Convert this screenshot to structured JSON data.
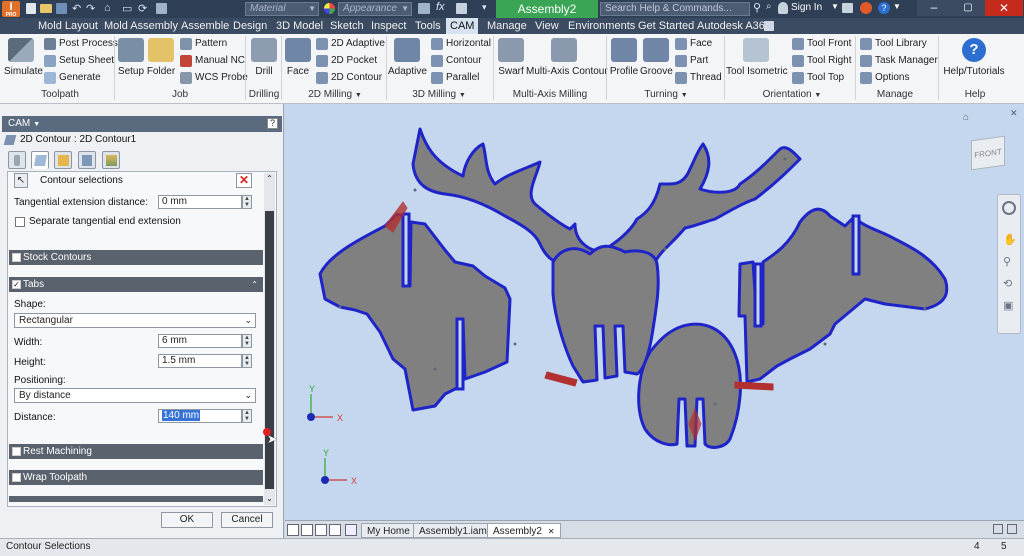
{
  "title": {
    "app_badge": "PRO",
    "quick_material": "Material",
    "quick_appearance": "Appearance",
    "fx": "fx",
    "document": "Assembly2",
    "search_placeholder": "Search Help & Commands...",
    "sign_in": "Sign In"
  },
  "menu": [
    "Mold Layout",
    "Mold Assembly",
    "Assemble",
    "Design",
    "3D Model",
    "Sketch",
    "Inspect",
    "Tools",
    "CAM",
    "Manage",
    "View",
    "Environments",
    "Get Started",
    "Autodesk A360"
  ],
  "menu_active": "CAM",
  "ribbon": {
    "simulate": "Simulate",
    "post_process": "Post Process",
    "setup_sheet": "Setup Sheet",
    "generate": "Generate",
    "setup": "Setup",
    "folder": "Folder",
    "pattern": "Pattern",
    "manual_nc": "Manual NC",
    "wcs_probe": "WCS Probe",
    "drill": "Drill",
    "face": "Face",
    "adaptive_2d": "2D Adaptive",
    "pocket_2d": "2D Pocket",
    "contour_2d": "2D Contour",
    "adaptive": "Adaptive",
    "horizontal": "Horizontal",
    "contour": "Contour",
    "parallel": "Parallel",
    "swarf": "Swarf",
    "multi_axis_contour": "Multi-Axis Contour",
    "profile": "Profile",
    "groove": "Groove",
    "t_face": "Face",
    "t_part": "Part",
    "t_thread": "Thread",
    "tool_isometric": "Tool Isometric",
    "tool_front": "Tool Front",
    "tool_right": "Tool Right",
    "tool_top": "Tool Top",
    "tool_library": "Tool Library",
    "task_manager": "Task Manager",
    "options": "Options",
    "help_tutorials": "Help/Tutorials",
    "groups": {
      "toolpath": "Toolpath",
      "job": "Job",
      "drilling": "Drilling",
      "milling_2d": "2D Milling",
      "milling_3d": "3D Milling",
      "multi_axis": "Multi-Axis Milling",
      "turning": "Turning",
      "orientation": "Orientation",
      "manage": "Manage",
      "help": "Help"
    }
  },
  "panel": {
    "header": "CAM",
    "help_glyph": "?",
    "breadcrumb": "2D Contour : 2D Contour1",
    "contour_selections": "Contour selections",
    "tangential_label": "Tangential extension distance:",
    "tangential_value": "0 mm",
    "separate_label": "Separate tangential end extension",
    "stock_contours": "Stock Contours",
    "tabs": "Tabs",
    "shape_label": "Shape:",
    "shape_value": "Rectangular",
    "width_label": "Width:",
    "width_value": "6 mm",
    "height_label": "Height:",
    "height_value": "1.5 mm",
    "positioning_label": "Positioning:",
    "positioning_value": "By distance",
    "distance_label": "Distance:",
    "distance_value": "140 mm",
    "rest_machining": "Rest Machining",
    "wrap_toolpath": "Wrap Toolpath",
    "ok": "OK",
    "cancel": "Cancel"
  },
  "viewcube_label": "FRONT",
  "axis": {
    "x": "X",
    "y": "Y"
  },
  "doc_tabs": [
    "My Home",
    "Assembly1.iam",
    "Assembly2"
  ],
  "doc_tab_active": "Assembly2",
  "status": {
    "text": "Contour Selections",
    "n1": "4",
    "n2": "5"
  },
  "colors": {
    "accent": "#3b4b62",
    "part_fill": "#808080",
    "part_stroke": "#1f24c8",
    "viewport_bg": "#c5d7ef",
    "tab_arrow": "#b23030"
  }
}
